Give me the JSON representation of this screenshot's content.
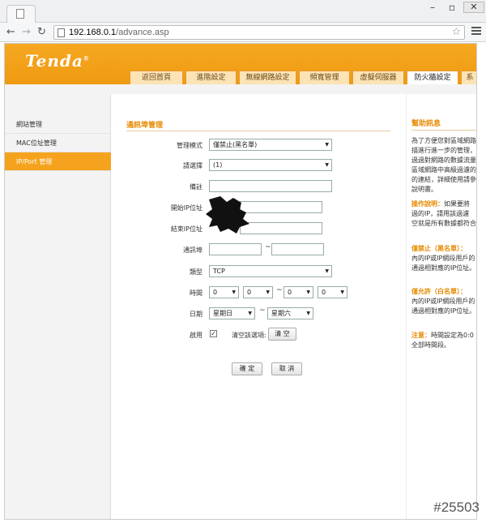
{
  "browser": {
    "url_host": "192.168.0.1",
    "url_path": "/advance.asp"
  },
  "brand": {
    "logo": "Tenda",
    "logo_mark": "®"
  },
  "nav_tabs": [
    {
      "label": "返回首頁"
    },
    {
      "label": "進階設定"
    },
    {
      "label": "無線網路設定"
    },
    {
      "label": "頻寬管理"
    },
    {
      "label": "虛擬伺服器"
    },
    {
      "label": "防火牆設定",
      "active": true
    },
    {
      "label": "系"
    }
  ],
  "sidebar": {
    "items": [
      {
        "label": "網站管理"
      },
      {
        "label": "MAC位址管理"
      },
      {
        "label": "IP/Port 管理",
        "active": true
      }
    ]
  },
  "form": {
    "title": "通訊埠管理",
    "mode_label": "管理模式",
    "mode_value": "僅禁止(黑名單)",
    "select_label": "請選擇",
    "select_value": "(1)",
    "remark_label": "備註",
    "start_ip_label": "開始IP位址",
    "end_ip_label": "結束IP位址",
    "port_label": "通訊埠",
    "type_label": "類型",
    "type_value": "TCP",
    "time_label": "時間",
    "time_values": [
      "0",
      "0",
      "0",
      "0"
    ],
    "date_label": "日期",
    "date_from": "星期日",
    "date_to": "星期六",
    "enable_label": "啟用",
    "clear_label": "清空該選項:",
    "clear_button": "清 空",
    "ok_button": "確 定",
    "cancel_button": "取 消",
    "tilde": "~"
  },
  "help": {
    "title": "幫助訊息",
    "intro": "為了方便您對區域網路\n描進行進一步的管理，\n過過對網路的數據流量\n區域網路中高級過濾的\n的連結，詳細使用請參\n說明書。",
    "op_title": "操作說明：",
    "op_body": "如果要將\n過的IP，請用該過濾\n空就是所有數據都符合",
    "deny_title": "僅禁止（黑名單）：",
    "deny_body": "\n內的IP或IP網段用戶的\n通過相對應的IP位址。",
    "allow_title": "僅允許（白名單）：",
    "allow_body": "\n內的IP或IP網段用戶的\n通過相對應的IP位址。",
    "note_title": "注意：",
    "note_body": "時間設定為0:0\n全部時間段。"
  },
  "watermark": "#25503"
}
